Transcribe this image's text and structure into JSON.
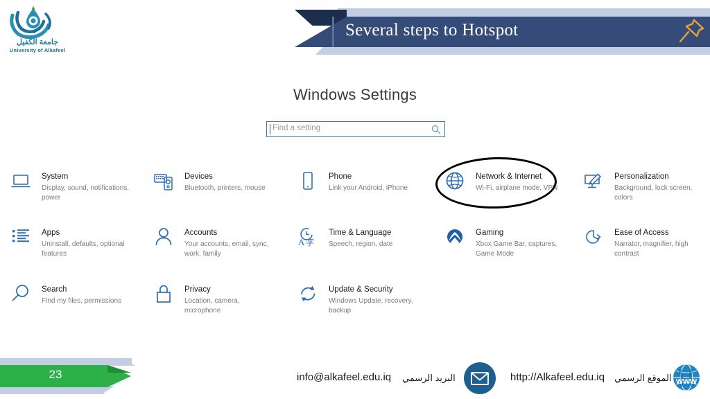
{
  "slide": {
    "banner_title": "Several steps to Hotspot",
    "page_number": "23",
    "pin_icon": "pushpin-icon"
  },
  "logo": {
    "arabic": "جامعة الكفيل",
    "english": "University of Alkafeel"
  },
  "windows_settings": {
    "title": "Windows Settings",
    "search": {
      "placeholder": "Find a setting",
      "value": "",
      "icon": "search-icon"
    },
    "items": [
      {
        "title": "System",
        "desc": "Display, sound, notifications, power",
        "icon": "laptop-icon",
        "highlighted": false
      },
      {
        "title": "Devices",
        "desc": "Bluetooth, printers, mouse",
        "icon": "devices-icon",
        "highlighted": false
      },
      {
        "title": "Phone",
        "desc": "Link your Android, iPhone",
        "icon": "phone-icon",
        "highlighted": false
      },
      {
        "title": "Network & Internet",
        "desc": "Wi-Fi, airplane mode, VPN",
        "icon": "globe-icon",
        "highlighted": true
      },
      {
        "title": "Personalization",
        "desc": "Background, lock screen, colors",
        "icon": "brush-icon",
        "highlighted": false
      },
      {
        "title": "Apps",
        "desc": "Uninstall, defaults, optional features",
        "icon": "list-icon",
        "highlighted": false
      },
      {
        "title": "Accounts",
        "desc": "Your accounts, email, sync, work, family",
        "icon": "person-icon",
        "highlighted": false
      },
      {
        "title": "Time & Language",
        "desc": "Speech, region, date",
        "icon": "clock-lang-icon",
        "highlighted": false
      },
      {
        "title": "Gaming",
        "desc": "Xbox Game Bar, captures, Game Mode",
        "icon": "xbox-icon",
        "highlighted": false
      },
      {
        "title": "Ease of Access",
        "desc": "Narrator, magnifier, high contrast",
        "icon": "accessibility-icon",
        "highlighted": false
      },
      {
        "title": "Search",
        "desc": "Find my files, permissions",
        "icon": "magnifier-icon",
        "highlighted": false
      },
      {
        "title": "Privacy",
        "desc": "Location, camera, microphone",
        "icon": "lock-icon",
        "highlighted": false
      },
      {
        "title": "Update & Security",
        "desc": "Windows Update, recovery, backup",
        "icon": "refresh-icon",
        "highlighted": false
      }
    ]
  },
  "footer": {
    "email": "info@alkafeel.edu.iq",
    "email_label_ar": "البريد الرسمي",
    "website": "http://Alkafeel.edu.iq",
    "website_label_ar": "الموقع الرسمي",
    "mail_icon": "envelope-icon",
    "globe_icon": "www-globe-icon"
  },
  "colors": {
    "banner_navy": "#344c77",
    "banner_fold": "#1d2d4d",
    "band_lavender": "#c3cde3",
    "accent_green": "#2eb048",
    "pin_gold": "#e8a33d",
    "settings_blue": "#2f6fb0",
    "logo_teal": "#1b7a9e",
    "highlight_ring": "#000000"
  }
}
